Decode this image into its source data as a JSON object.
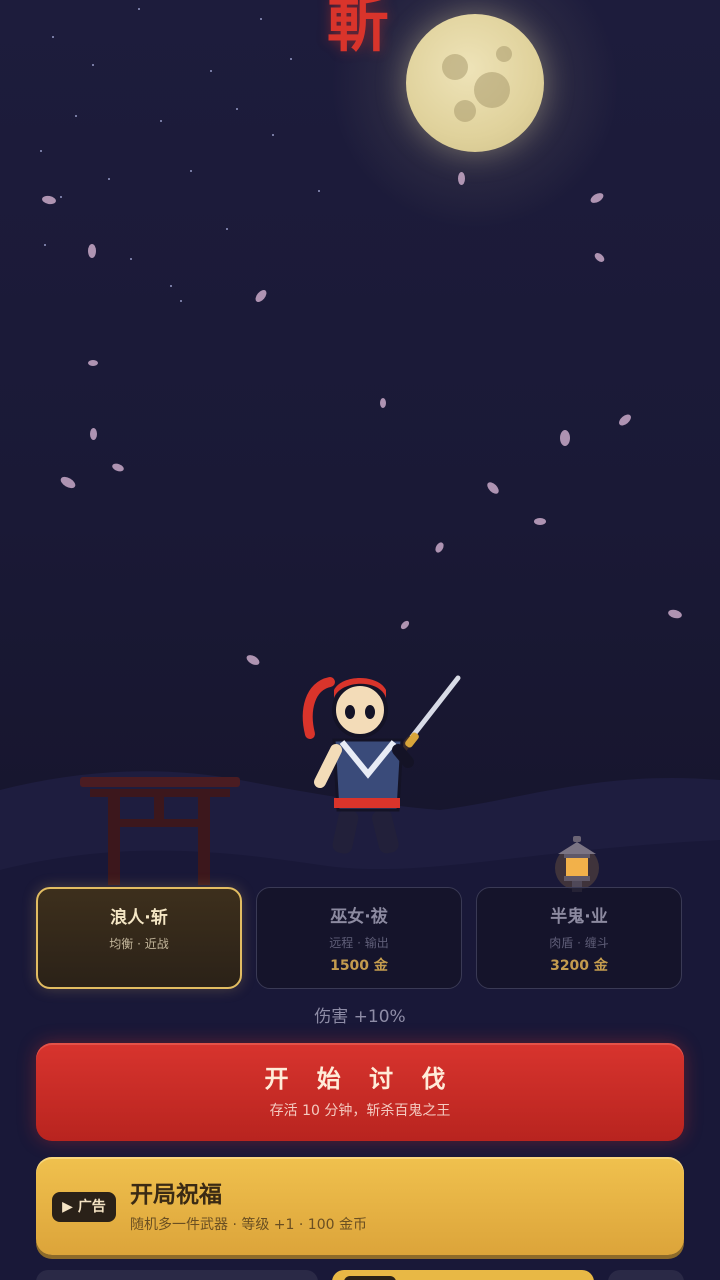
{
  "title": "斬",
  "characters": [
    {
      "name": "浪人·斩",
      "role": "均衡 · 近战",
      "price": "",
      "selected": true
    },
    {
      "name": "巫女·祓",
      "role": "远程 · 输出",
      "price": "1500 金",
      "selected": false
    },
    {
      "name": "半鬼·业",
      "role": "肉盾 · 缠斗",
      "price": "3200 金",
      "selected": false
    }
  ],
  "bonus_text": "伤害 +10%",
  "start_button": {
    "title": "开 始 讨 伐",
    "subtitle": "存活 10 分钟，斩杀百鬼之王"
  },
  "blessing_button": {
    "badge": "▶ 广告",
    "title": "开局祝福",
    "subtitle": "随机多一件武器 · 等级 +1 · 100 金币"
  },
  "colors": {
    "accent_red": "#d8342e",
    "gold": "#e2bd62",
    "background": "#1a1936"
  }
}
